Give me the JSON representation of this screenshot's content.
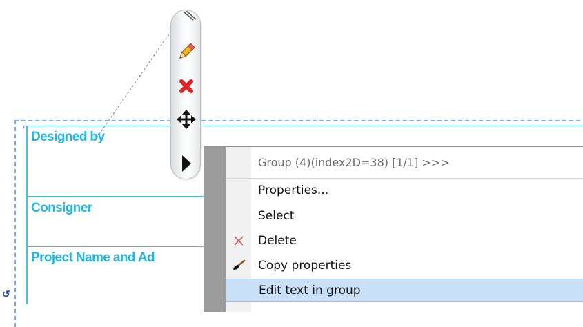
{
  "table": {
    "row1": "Designed by",
    "row2": "Consigner",
    "row3": "Project Name and Ad"
  },
  "toolbar": {
    "buttons": [
      "pencil-icon",
      "delete-x-icon",
      "move-icon",
      "expand-arrow-icon"
    ]
  },
  "context_menu": {
    "header": "Group (4)(index2D=38) [1/1] >>>",
    "items": [
      {
        "label": "Properties...",
        "icon": ""
      },
      {
        "label": "Select",
        "icon": ""
      },
      {
        "label": "Delete",
        "icon": "delete-icon"
      },
      {
        "label": "Copy properties",
        "icon": "brush-icon"
      },
      {
        "label": "Edit text in group",
        "icon": ""
      }
    ],
    "highlighted_index": 4
  },
  "colors": {
    "table_text": "#22b7e3",
    "table_line": "#3ec6e8",
    "selection": "#7fa8e6",
    "menu_highlight": "#c9dff6"
  }
}
